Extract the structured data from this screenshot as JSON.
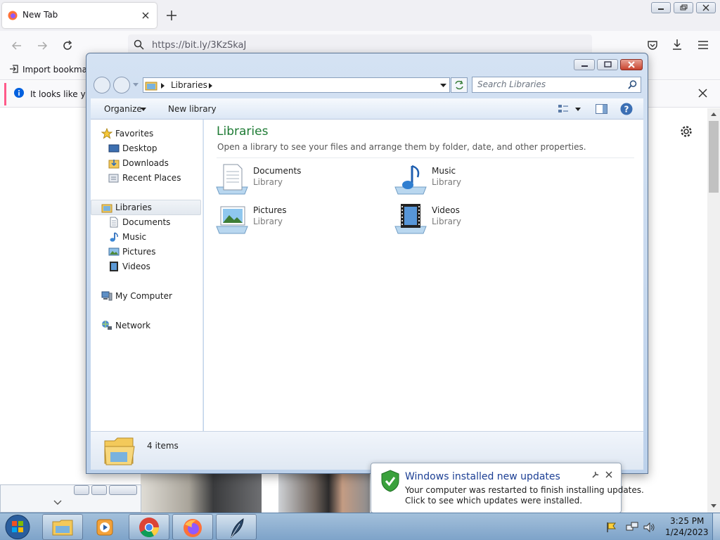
{
  "browser": {
    "tab_title": "New Tab",
    "url": "https://bit.ly/3KzSkaJ",
    "bookmark_import": "Import bookmark",
    "notice_text": "It looks like you"
  },
  "explorer": {
    "breadcrumb": "Libraries",
    "search_placeholder": "Search Libraries",
    "organize_label": "Organize",
    "new_library_label": "New library",
    "nav": {
      "favorites": "Favorites",
      "desktop": "Desktop",
      "downloads": "Downloads",
      "recent_places": "Recent Places",
      "libraries": "Libraries",
      "documents": "Documents",
      "music": "Music",
      "pictures": "Pictures",
      "videos": "Videos",
      "my_computer": "My Computer",
      "network": "Network"
    },
    "heading": "Libraries",
    "description": "Open a library to see your files and arrange them by folder, date, and other properties.",
    "libraries": [
      {
        "name": "Documents",
        "type": "Library"
      },
      {
        "name": "Music",
        "type": "Library"
      },
      {
        "name": "Pictures",
        "type": "Library"
      },
      {
        "name": "Videos",
        "type": "Library"
      }
    ],
    "item_count": "4 items"
  },
  "toast": {
    "title": "Windows installed new updates",
    "line1": "Your computer was restarted to finish installing updates.",
    "line2": "Click to see which updates were installed."
  },
  "clock": {
    "time": "3:25 PM",
    "date": "1/24/2023"
  },
  "colors": {
    "accent_green": "#1e7b34",
    "explorer_frame": "#c7d8ee",
    "taskbar": "#8fb0d2"
  }
}
